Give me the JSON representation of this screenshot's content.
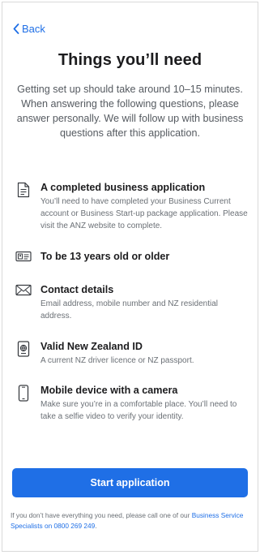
{
  "nav": {
    "back_label": "Back"
  },
  "page": {
    "title": "Things you’ll need",
    "intro": "Getting set up should take around 10–15 minutes. When answering the following questions, please answer personally. We will follow up with business questions after this application."
  },
  "items": [
    {
      "icon": "document-icon",
      "title": "A completed business application",
      "description": "You’ll need to have completed your Business Current account or Business Start-up package application. Please visit the ANZ website to complete."
    },
    {
      "icon": "id-card-icon",
      "title": "To be 13 years old or older",
      "description": ""
    },
    {
      "icon": "envelope-icon",
      "title": "Contact details",
      "description": "Email address, mobile number and NZ residential address."
    },
    {
      "icon": "passport-icon",
      "title": "Valid New Zealand ID",
      "description": "A current NZ driver licence or NZ passport."
    },
    {
      "icon": "mobile-phone-icon",
      "title": "Mobile device with a camera",
      "description": "Make sure you’re in a comfortable place. You’ll need to take a selfie video to verify your identity."
    }
  ],
  "actions": {
    "start_label": "Start application"
  },
  "footer": {
    "text": "If you don’t have everything you need, please call one of our ",
    "link": "Business Service Specialists on 0800 269 249",
    "end": "."
  },
  "colors": {
    "accent": "#1f6fe6",
    "text": "#1c1c1e",
    "muted": "#6b7076"
  }
}
